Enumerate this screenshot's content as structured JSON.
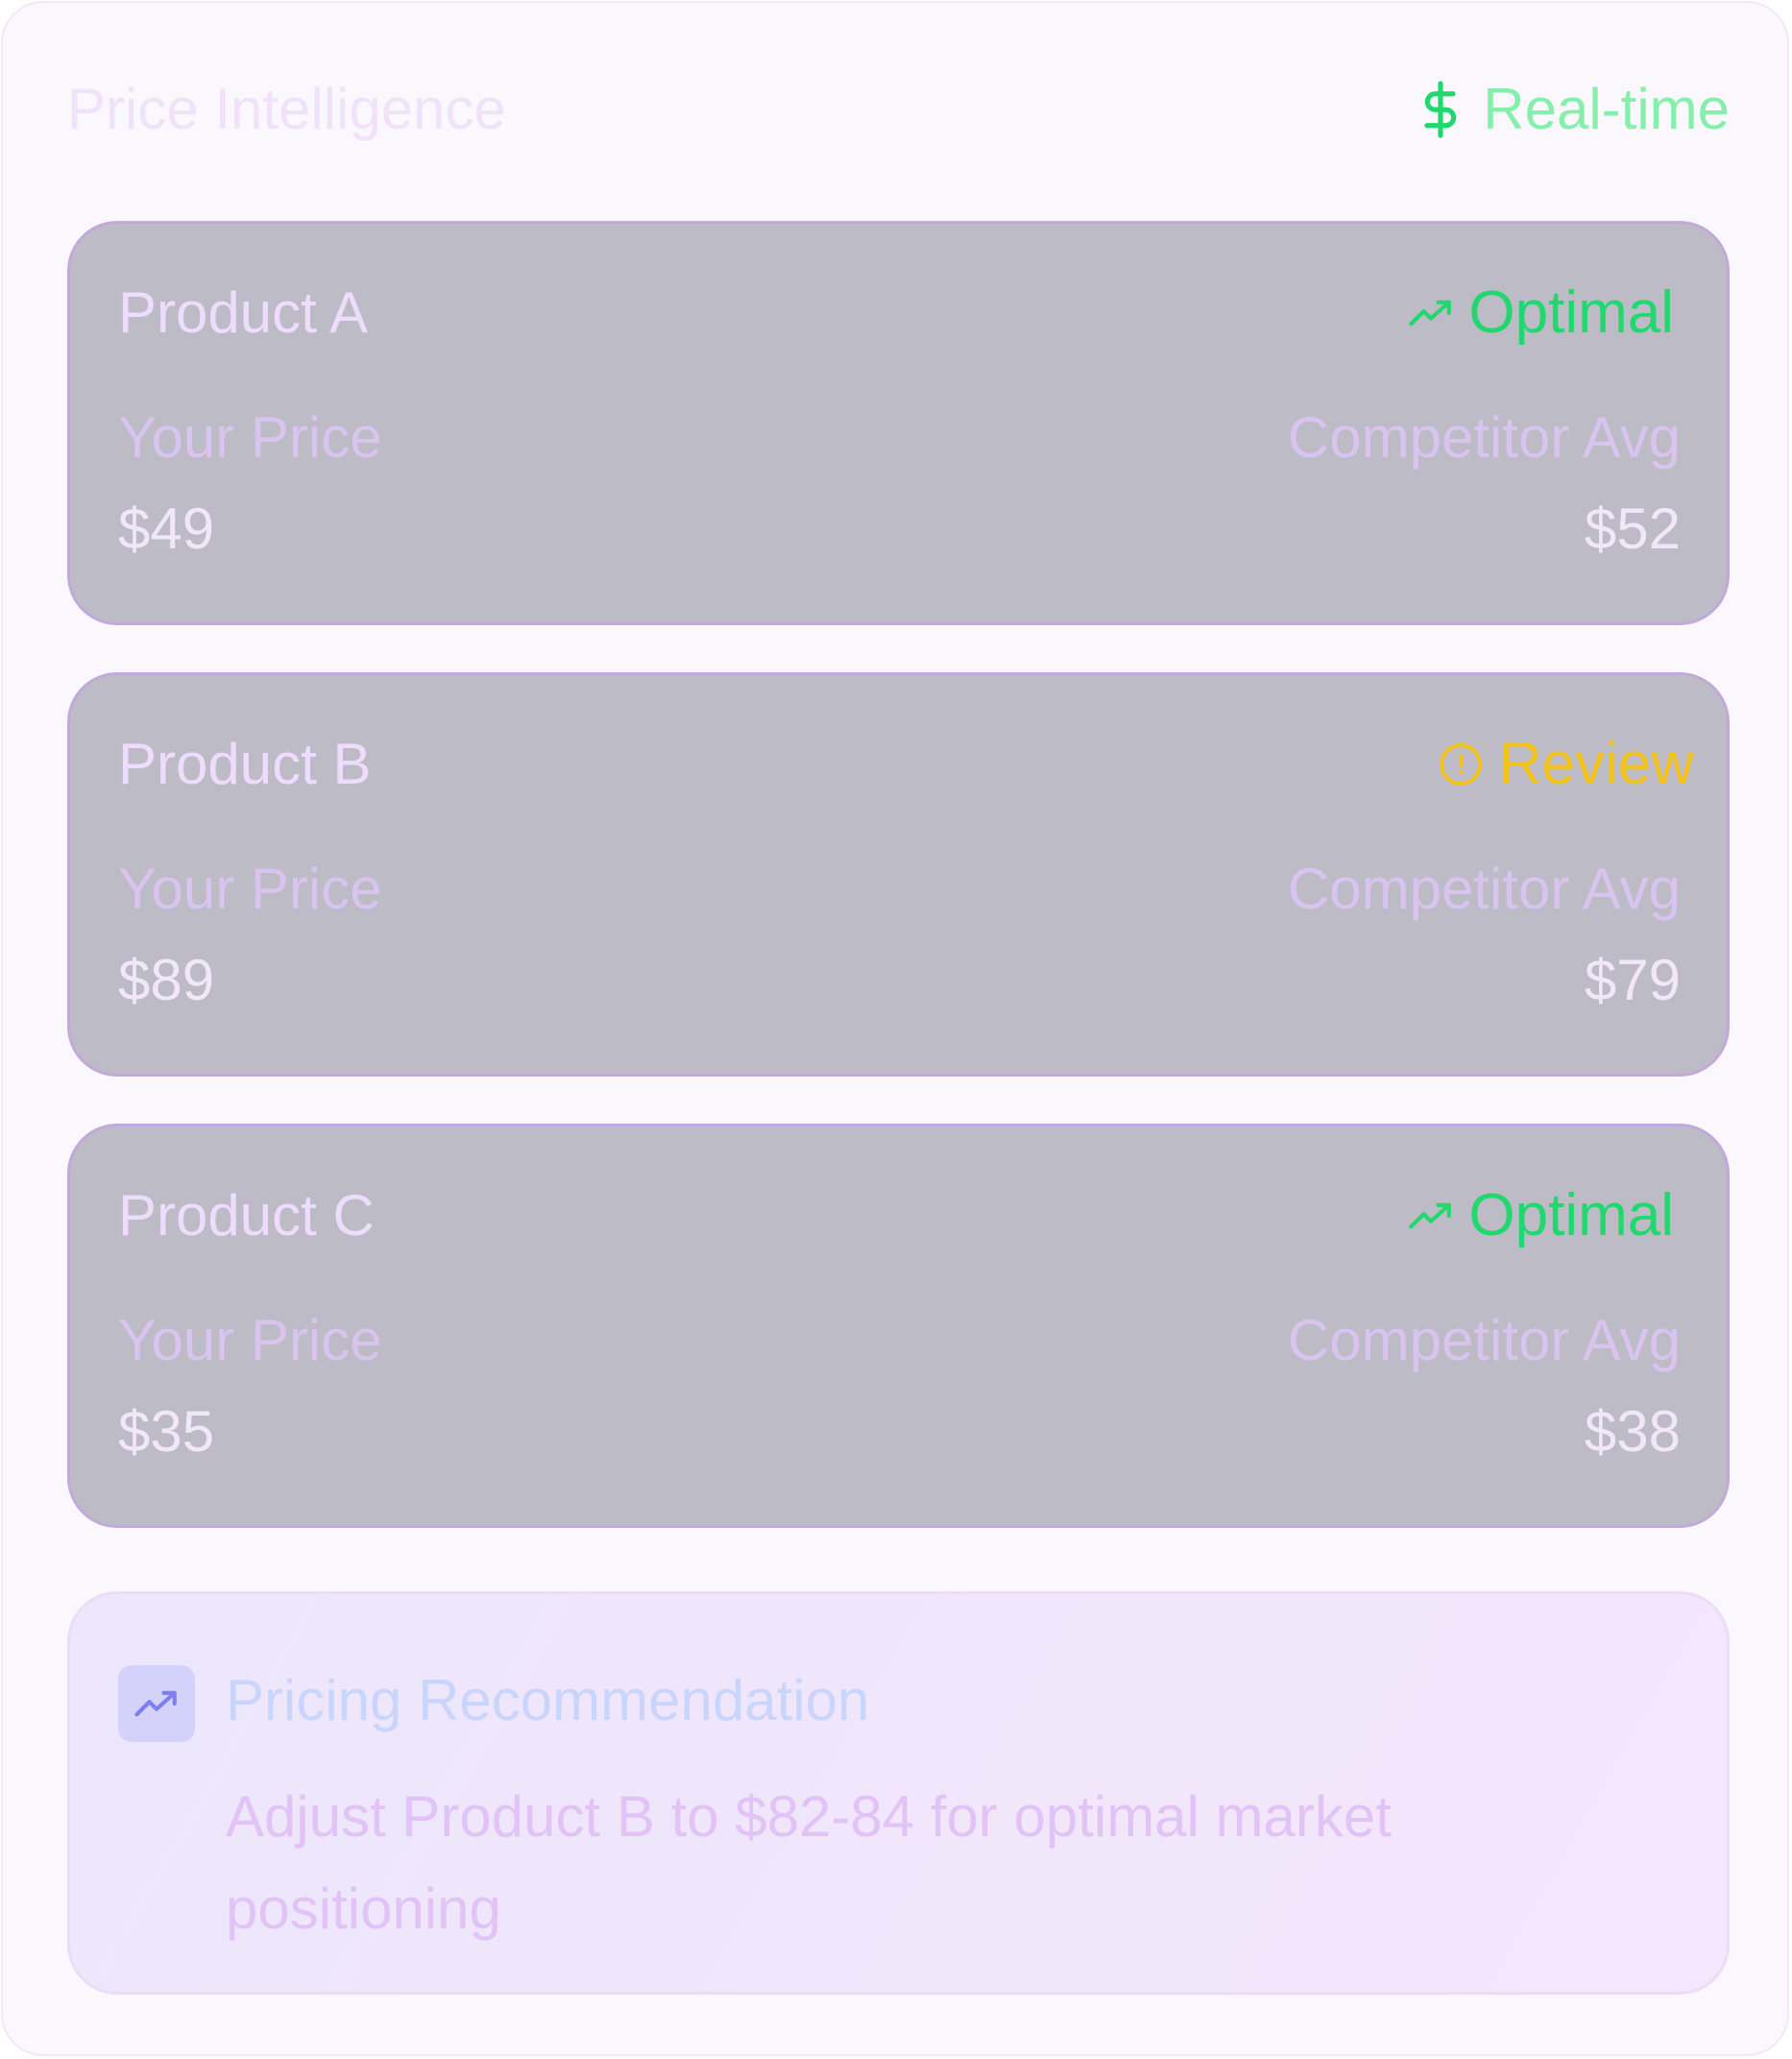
{
  "header": {
    "title": "Price Intelligence",
    "badge_label": "Real-time",
    "badge_icon": "dollar-icon"
  },
  "colors": {
    "optimal": "#22d86e",
    "review": "#f2c21b",
    "realtime_label": "#86efac",
    "card_bg": "#bcbbc6"
  },
  "labels": {
    "your_price": "Your Price",
    "competitor_avg": "Competitor Avg"
  },
  "products": [
    {
      "name": "Product A",
      "status": "Optimal",
      "status_icon": "trending-up-icon",
      "your_price": "$49",
      "competitor_avg": "$52"
    },
    {
      "name": "Product B",
      "status": "Review",
      "status_icon": "alert-circle-icon",
      "your_price": "$89",
      "competitor_avg": "$79"
    },
    {
      "name": "Product C",
      "status": "Optimal",
      "status_icon": "trending-up-icon",
      "your_price": "$35",
      "competitor_avg": "$38"
    }
  ],
  "recommendation": {
    "icon": "trending-up-icon",
    "title": "Pricing Recommendation",
    "text": "Adjust Product B to $82-84 for optimal market positioning"
  }
}
